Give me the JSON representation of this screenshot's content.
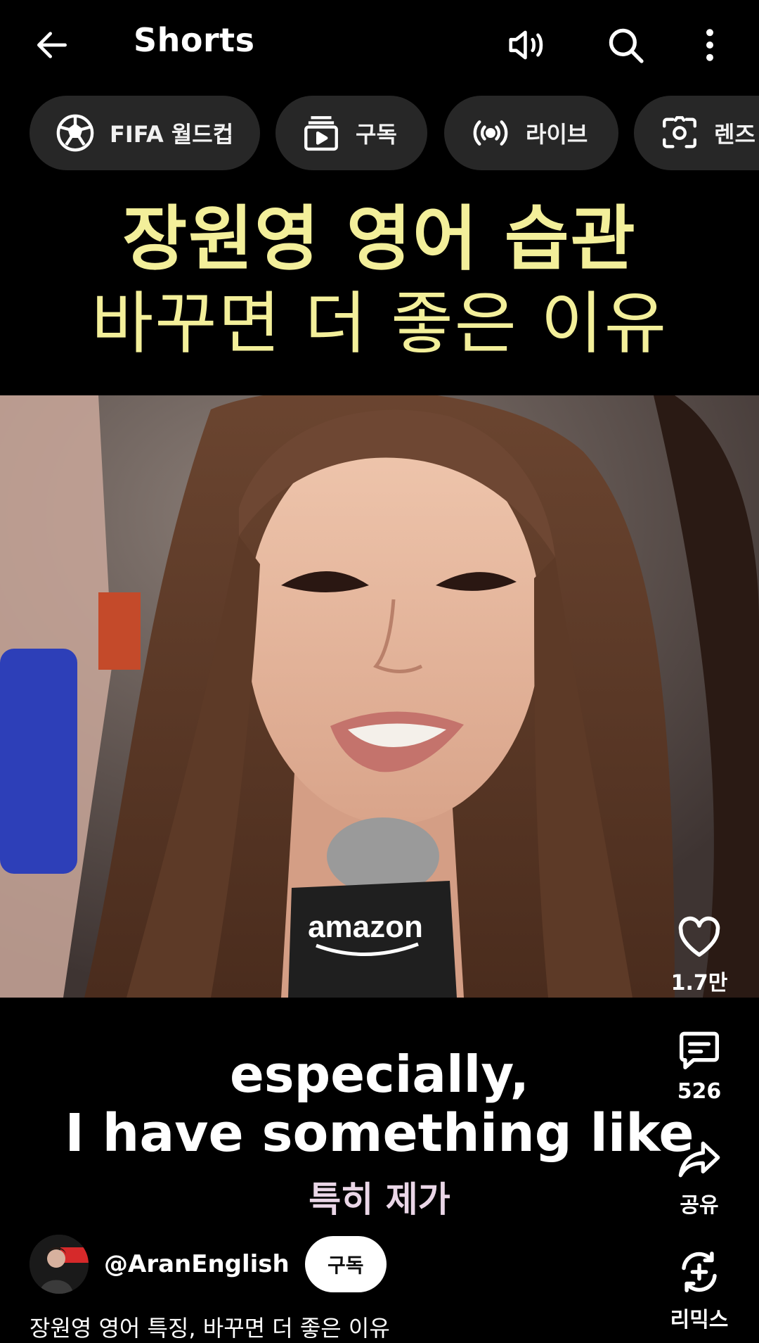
{
  "header": {
    "title": "Shorts",
    "back_icon": "arrow-left-icon",
    "sound_icon": "speaker-icon",
    "search_icon": "search-icon",
    "more_icon": "more-vertical-icon"
  },
  "chips": [
    {
      "label": "FIFA 월드컵",
      "icon": "soccer-ball-icon"
    },
    {
      "label": "구독",
      "icon": "subscriptions-icon"
    },
    {
      "label": "라이브",
      "icon": "live-broadcast-icon"
    },
    {
      "label": "렌즈",
      "icon": "camera-lens-icon"
    }
  ],
  "video": {
    "headline_line1": "장원영 영어 습관",
    "headline_line2": "바꾸면 더 좋은 이유",
    "mic_brand": "amazon",
    "caption_line1": "especially,",
    "caption_line2": "I have something like",
    "caption_korean": "특히 제가"
  },
  "actions": {
    "like_count": "1.7만",
    "comment_count": "526",
    "share_label": "공유",
    "remix_label": "리믹스"
  },
  "channel": {
    "handle": "@AranEnglish",
    "subscribe_label": "구독",
    "description": "장원영 영어 특징, 바꾸면 더 좋은 이유"
  },
  "colors": {
    "background": "#000000",
    "chip_bg": "#272727",
    "headline": "#f3ef9a",
    "caption_korean": "#ead6e7"
  }
}
